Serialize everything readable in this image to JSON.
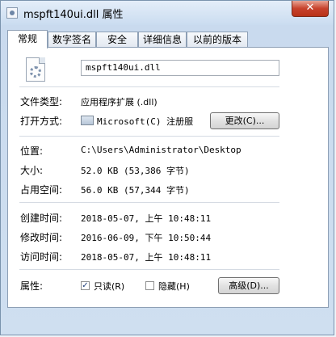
{
  "window": {
    "title": "mspft140ui.dll 属性",
    "close": "✕"
  },
  "tabs": [
    "常规",
    "数字签名",
    "安全",
    "详细信息",
    "以前的版本"
  ],
  "general": {
    "filename": "mspft140ui.dll",
    "type_label": "文件类型:",
    "type_value": "应用程序扩展 (.dll)",
    "openwith_label": "打开方式:",
    "openwith_value": "Microsoft(C) 注册服",
    "change_button": "更改(C)...",
    "location_label": "位置:",
    "location_value": "C:\\Users\\Administrator\\Desktop",
    "size_label": "大小:",
    "size_value": "52.0 KB (53,386 字节)",
    "disksize_label": "占用空间:",
    "disksize_value": "56.0 KB (57,344 字节)",
    "created_label": "创建时间:",
    "created_value": "2018-05-07, 上午 10:48:11",
    "modified_label": "修改时间:",
    "modified_value": "2016-06-09, 下午 10:50:44",
    "accessed_label": "访问时间:",
    "accessed_value": "2018-05-07, 上午 10:48:11",
    "attributes_label": "属性:",
    "readonly_label": "只读(R)",
    "readonly_checked": true,
    "hidden_label": "隐藏(H)",
    "hidden_checked": false,
    "advanced_button": "高级(D)..."
  }
}
